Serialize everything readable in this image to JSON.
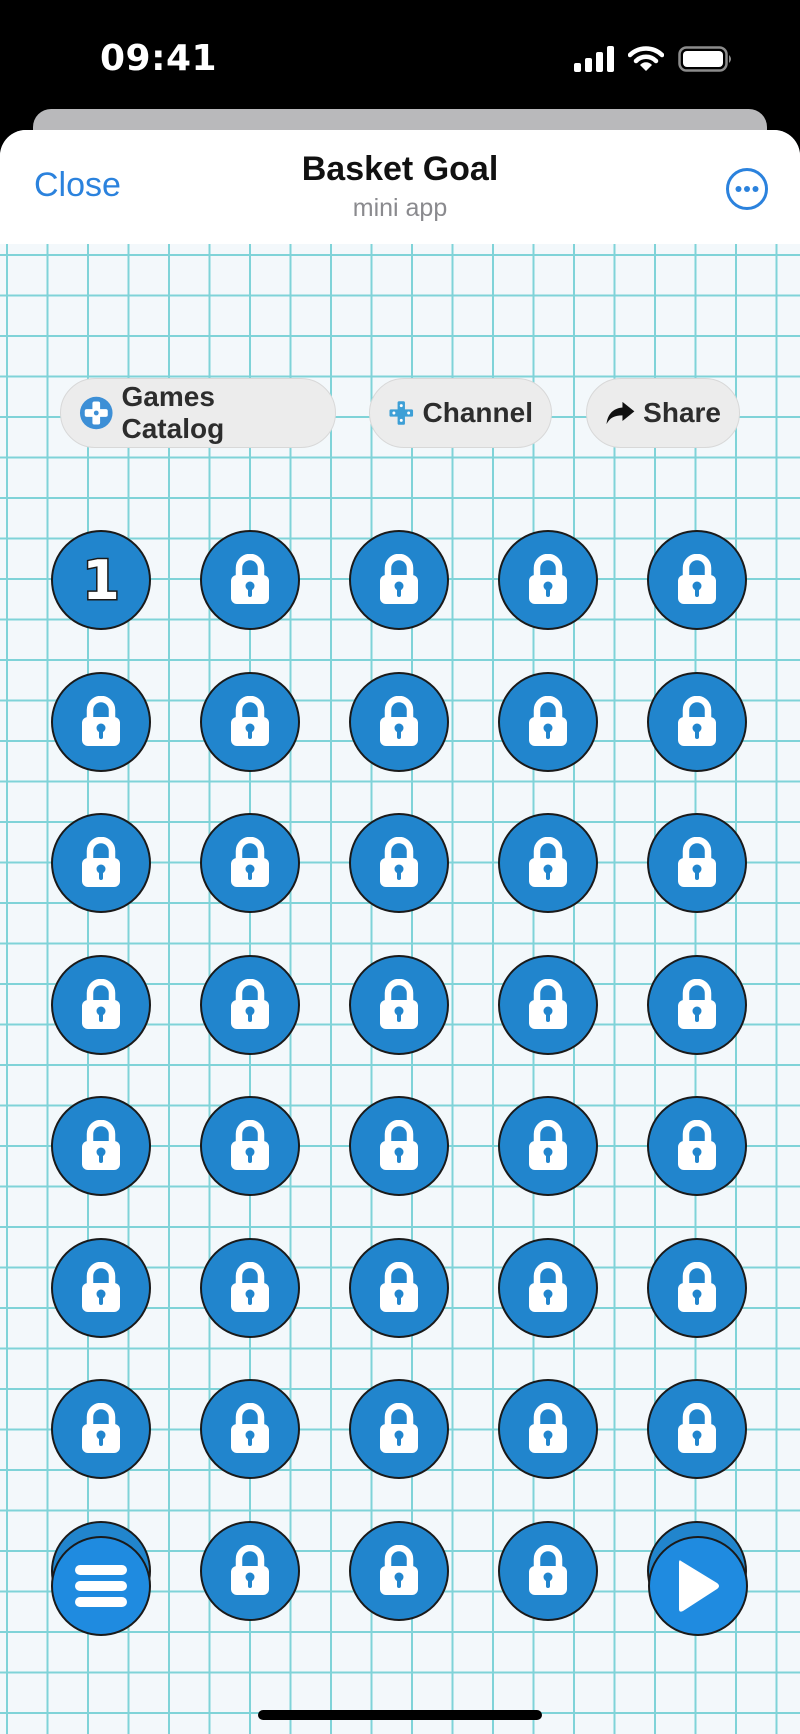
{
  "status": {
    "time": "09:41"
  },
  "header": {
    "close_label": "Close",
    "title": "Basket Goal",
    "subtitle": "mini app",
    "more_icon": "more-icon"
  },
  "actions": [
    {
      "label": "Games Catalog",
      "icon": "games-catalog-icon"
    },
    {
      "label": "Channel",
      "icon": "channel-icon"
    },
    {
      "label": "Share",
      "icon": "share-icon"
    }
  ],
  "levels": {
    "columns": 5,
    "rows": 8,
    "unlocked": [
      {
        "number": "1"
      }
    ],
    "locked_count": 39
  },
  "footer": {
    "menu_icon": "menu-icon",
    "play_icon": "play-icon"
  },
  "colors": {
    "accent": "#2b82dd",
    "level_fill": "#2185cd",
    "grid_line": "#7fd3d8",
    "background": "#f3f8fb"
  }
}
